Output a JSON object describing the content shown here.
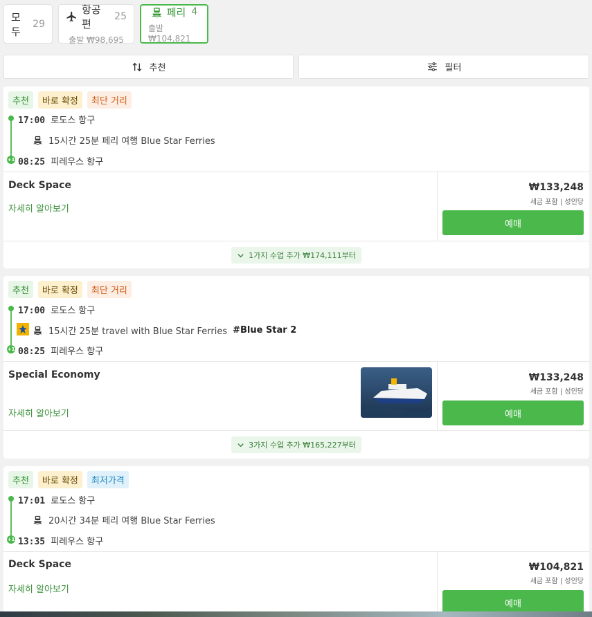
{
  "tabs": [
    {
      "label": "모두",
      "count": "29"
    },
    {
      "label": "항공편",
      "count": "25",
      "sub_label": "출발",
      "price": "₩98,695",
      "icon": "plane-icon"
    },
    {
      "label": "페리",
      "count": "4",
      "sub_label": "출발",
      "price": "₩104,821",
      "icon": "ferry-icon"
    }
  ],
  "toolbar": {
    "sort_label": "추천",
    "filter_label": "필터"
  },
  "cards": [
    {
      "tags": [
        "추천",
        "바로 확정",
        "최단 거리"
      ],
      "depart_time": "17:00",
      "depart_place": "로도스 항구",
      "leg_text": "15시간 25분 페리 여행 Blue Star Ferries",
      "arrive_time": "08:25",
      "arrive_place": "피레우스 항구",
      "day_offset": "+1",
      "class_name": "Deck Space",
      "details": "자세히 알아보기",
      "price": "₩133,248",
      "price_note": "세금 포함 | 성인당",
      "book_label": "예매",
      "more_label": "1가지 수업 추가 ₩174,111부터"
    },
    {
      "tags": [
        "추천",
        "바로 확정",
        "최단 거리"
      ],
      "depart_time": "17:00",
      "depart_place": "로도스 항구",
      "leg_text": "15시간 25분 travel with Blue Star Ferries",
      "leg_vessel": "#Blue Star 2",
      "arrive_time": "08:25",
      "arrive_place": "피레우스 항구",
      "day_offset": "+1",
      "class_name": "Special Economy",
      "details": "자세히 알아보기",
      "price": "₩133,248",
      "price_note": "세금 포함 | 성인당",
      "book_label": "예매",
      "more_label": "3가지 수업 추가 ₩165,227부터"
    },
    {
      "tags": [
        "추천",
        "바로 확정",
        "최저가격"
      ],
      "depart_time": "17:01",
      "depart_place": "로도스 항구",
      "leg_text": "20시간 34분 페리 여행 Blue Star Ferries",
      "arrive_time": "13:35",
      "arrive_place": "피레우스 항구",
      "day_offset": "+1",
      "class_name": "Deck Space",
      "details": "자세히 알아보기",
      "price": "₩104,821",
      "price_note": "세금 포함 | 성인당",
      "book_label": "예매"
    }
  ],
  "colors": {
    "accent": "#4bb84b",
    "accent_text": "#3a8f3a"
  }
}
